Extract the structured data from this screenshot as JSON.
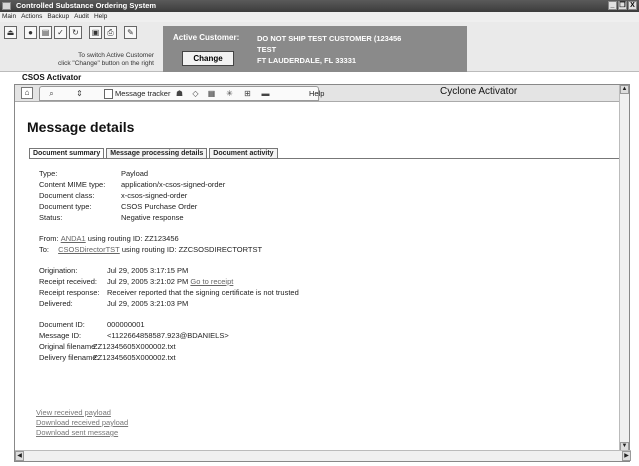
{
  "window": {
    "title": "Controlled Substance Ordering System",
    "controls": [
      "_",
      "❒",
      "X"
    ]
  },
  "menu": [
    "Main",
    "Actions",
    "Backup",
    "Audit",
    "Help"
  ],
  "toolbar": {
    "icons": [
      "exit-icon",
      "stop-icon",
      "form-icon",
      "check-icon",
      "refresh-icon",
      "save-icon",
      "print-icon",
      "signature-icon"
    ],
    "switch_note_line1": "To switch Active Customer",
    "switch_note_line2": "click \"Change\" button on the right"
  },
  "customer": {
    "label": "Active Customer:",
    "change_label": "Change",
    "line1": "DO NOT SHIP TEST CUSTOMER (123456",
    "line2": "TEST",
    "line3": "FT LAUDERDALE, FL 33331"
  },
  "panel_title": "CSOS Activator",
  "nav": {
    "message_tracker": "Message tracker",
    "help": "Help",
    "product": "Cyclone Activator"
  },
  "page": {
    "heading": "Message details",
    "tabs": [
      "Document summary",
      "Message processing details",
      "Document activity"
    ]
  },
  "summary": {
    "type_k": "Type:",
    "type_v": "Payload",
    "mime_k": "Content MIME type:",
    "mime_v": "application/x-csos-signed-order",
    "class_k": "Document class:",
    "class_v": "x-csos-signed-order",
    "doctype_k": "Document type:",
    "doctype_v": "CSOS Purchase Order",
    "status_k": "Status:",
    "status_v": "Negative response",
    "from_k": "From:",
    "from_link": "ANDA1",
    "from_rest": "using routing ID: ZZ123456",
    "to_k": "To:",
    "to_link": "CSOSDirectorTST",
    "to_rest": "using routing ID: ZZCSOSDIRECTORTST",
    "orig_k": "Origination:",
    "orig_v": "Jul 29, 2005 3:17:15 PM",
    "recv_k": "Receipt received:",
    "recv_v": "Jul 29, 2005 3:21:02 PM",
    "recv_link": "Go to receipt",
    "resp_k": "Receipt response:",
    "resp_v": "Receiver reported that the signing certificate is not trusted",
    "deliv_k": "Delivered:",
    "deliv_v": "Jul 29, 2005 3:21:03 PM",
    "docid_k": "Document ID:",
    "docid_v": "000000001",
    "msgid_k": "Message ID:",
    "msgid_v": "<1122664858587.923@BDANIELS>",
    "origfile_k": "Original filename:",
    "origfile_v": "ZZ12345605X000002.txt",
    "delivfile_k": "Delivery filename:",
    "delivfile_v": "ZZ12345605X000002.txt"
  },
  "downloads": [
    "View received payload",
    "Download received payload",
    "Download sent message"
  ]
}
